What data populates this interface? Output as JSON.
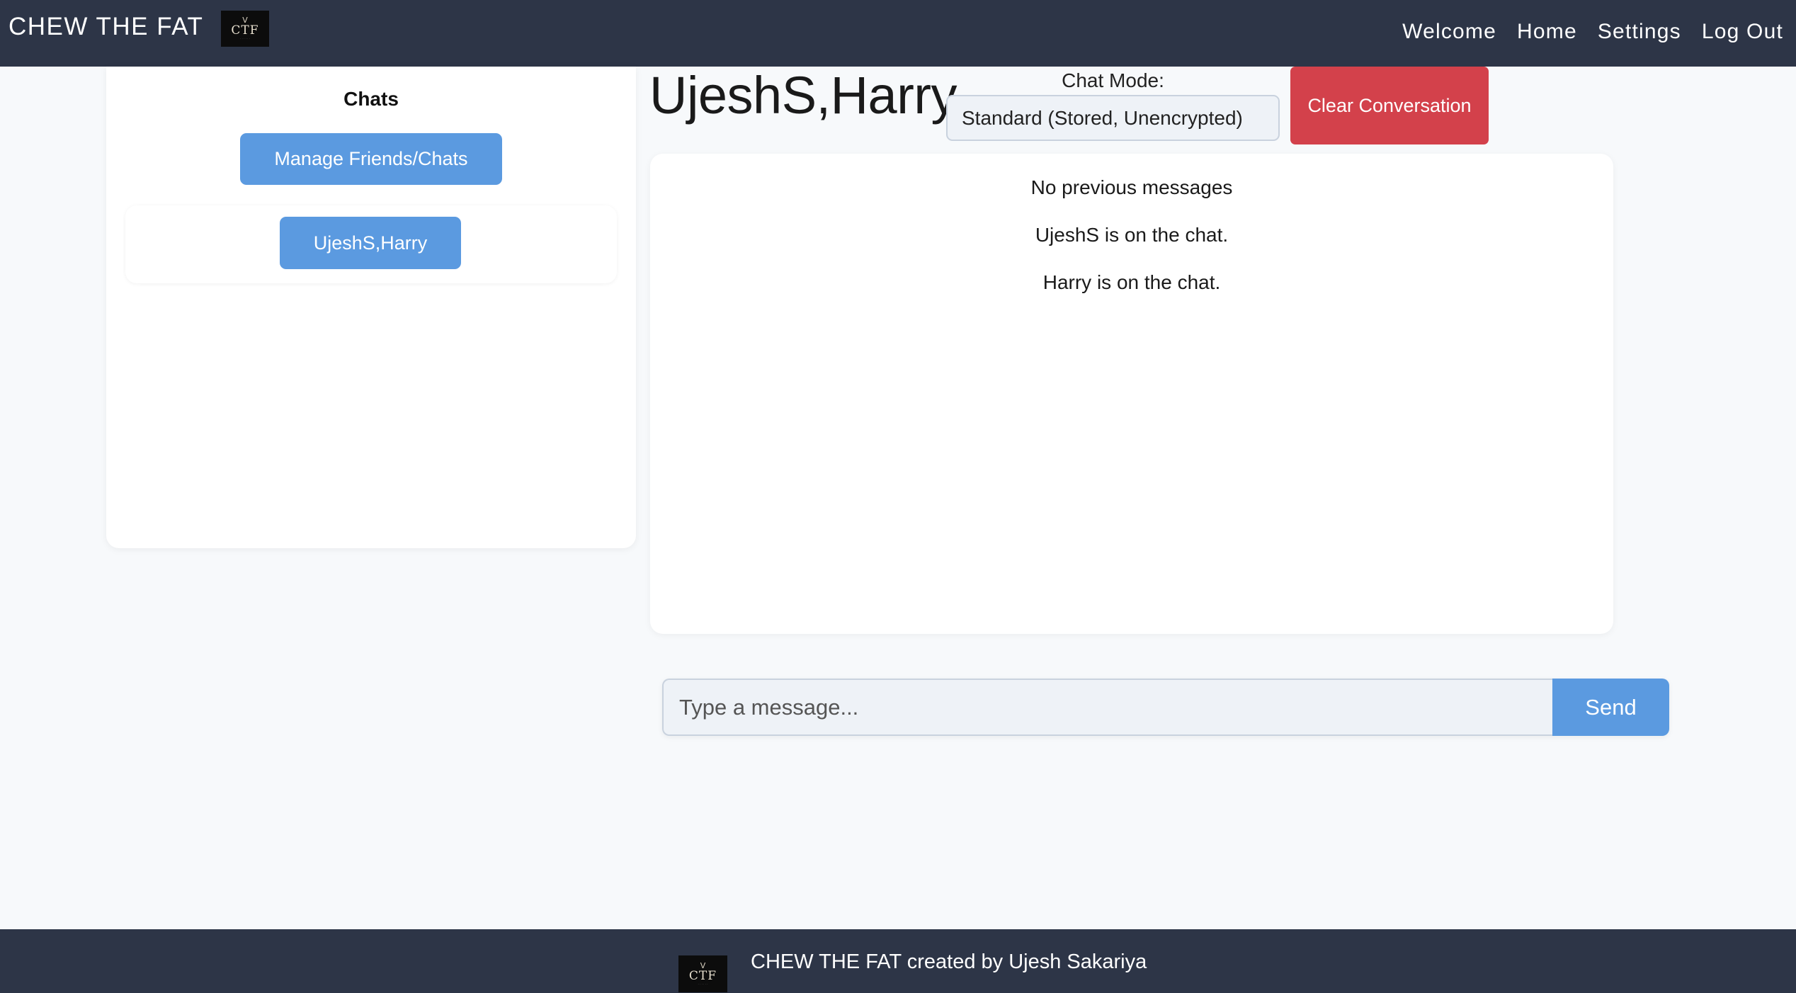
{
  "header": {
    "brand": "CHEW THE FAT",
    "logo_text": "CTF",
    "nav": [
      "Welcome",
      "Home",
      "Settings",
      "Log Out"
    ]
  },
  "sidebar": {
    "title": "Chats",
    "manage_button": "Manage Friends/Chats",
    "chats": [
      "UjeshS,Harry"
    ]
  },
  "chat": {
    "title": "UjeshS,Harry",
    "mode_label": "Chat Mode:",
    "mode_value": "Standard (Stored, Unencrypted)",
    "clear_button": "Clear Conversation",
    "messages": [
      "No previous messages",
      "UjeshS is on the chat.",
      "Harry is on the chat."
    ]
  },
  "composer": {
    "placeholder": "Type a message...",
    "send_label": "Send"
  },
  "footer": {
    "logo_text": "CTF",
    "text": "CHEW THE FAT created by Ujesh Sakariya"
  },
  "colors": {
    "navbar": "#2d3547",
    "primary_button": "#5b9ae0",
    "danger_button": "#d3414b",
    "page_background": "#f7f9fb"
  },
  "icons": [
    "ctf-logo-icon"
  ]
}
